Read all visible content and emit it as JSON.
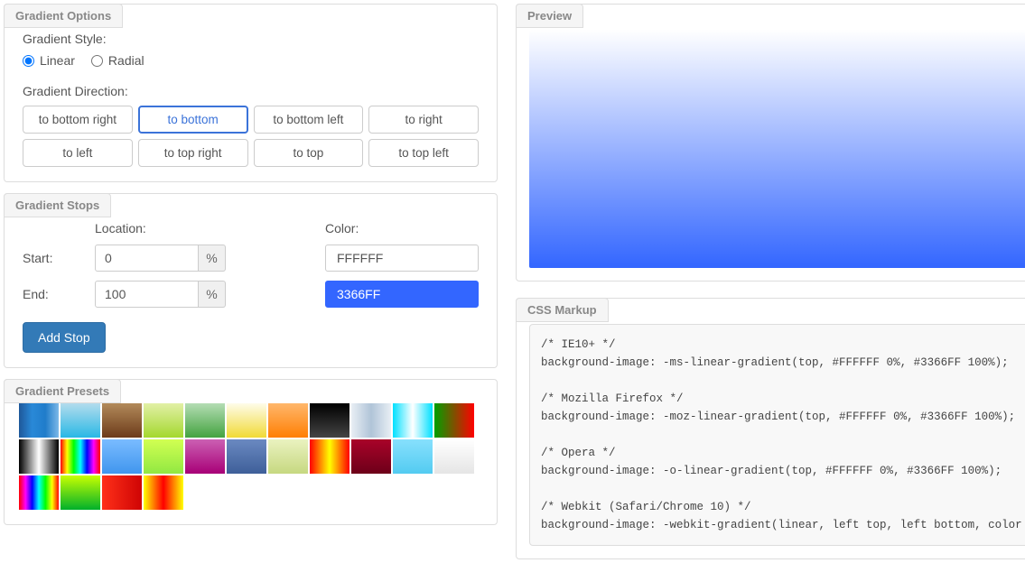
{
  "options": {
    "title": "Gradient Options",
    "styleLabel": "Gradient Style:",
    "styles": {
      "linear": "Linear",
      "radial": "Radial",
      "selected": "linear"
    },
    "directionLabel": "Gradient Direction:",
    "directions": [
      "to bottom right",
      "to bottom",
      "to bottom left",
      "to right",
      "to left",
      "to top right",
      "to top",
      "to top left"
    ],
    "directionActive": "to bottom"
  },
  "stops": {
    "title": "Gradient Stops",
    "locationHdr": "Location:",
    "colorHdr": "Color:",
    "pct": "%",
    "rows": [
      {
        "label": "Start:",
        "loc": "0",
        "color": "FFFFFF",
        "cls": "white"
      },
      {
        "label": "End:",
        "loc": "100",
        "color": "3366FF",
        "cls": "blue"
      }
    ],
    "addBtn": "Add Stop"
  },
  "presets": {
    "title": "Gradient Presets",
    "items": [
      "linear-gradient(to right,#1e5799,#2989d8,#207cca,#7db9e8)",
      "linear-gradient(to bottom,#b3dced,#29b8e5)",
      "linear-gradient(to bottom,#b28a5a,#6d3b1a)",
      "linear-gradient(to bottom,#e2f0a6,#a4d82e)",
      "linear-gradient(to bottom,#b4ddb4,#44a340)",
      "linear-gradient(to bottom,#fefcea,#f1da36)",
      "linear-gradient(to bottom,#ffb76b,#ff7f04)",
      "linear-gradient(to bottom,#000000,#444444)",
      "linear-gradient(to right,#e8eef4,#b0c4d8,#e8eef4)",
      "linear-gradient(to right,#00e0ff,#ffffff,#00e0ff)",
      "linear-gradient(to right,#00a000,#ff0000)",
      "linear-gradient(to right,#000000,#ffffff,#000000)",
      "linear-gradient(to right,#ff0000,#ffff00,#00ff00,#00ffff,#0000ff,#ff00ff,#ff0000)",
      "linear-gradient(to bottom,#7abcff,#4096ee)",
      "linear-gradient(to bottom,#d2ff52,#91e842)",
      "linear-gradient(to bottom,#cb60b3,#a80077)",
      "linear-gradient(to bottom,#6a89c1,#3e5f99)",
      "linear-gradient(to bottom,#eaf2c0,#c6d880)",
      "linear-gradient(to right,#ff0000,#ffff00,#ff0000)",
      "linear-gradient(to bottom,#a90329,#6d0019)",
      "linear-gradient(to bottom,#87e0fd,#53cbf1)",
      "linear-gradient(to bottom,#ffffff,#e5e5e5)",
      "linear-gradient(to right,#ff0000,#ff00ff,#0000ff,#00ffff,#00ff00,#ffff00,#ff0000)",
      "linear-gradient(to bottom,#c9ff00,#00b02b)",
      "linear-gradient(to right,#ff3019,#cf0404)",
      "linear-gradient(to right,#ffff00,#ff0000,#ffff00)"
    ]
  },
  "preview": {
    "title": "Preview",
    "css": "linear-gradient(to bottom,#FFFFFF 0%,#3366FF 100%)"
  },
  "markup": {
    "title": "CSS Markup",
    "code": "/* IE10+ */\nbackground-image: -ms-linear-gradient(top, #FFFFFF 0%, #3366FF 100%);\n\n/* Mozilla Firefox */\nbackground-image: -moz-linear-gradient(top, #FFFFFF 0%, #3366FF 100%);\n\n/* Opera */\nbackground-image: -o-linear-gradient(top, #FFFFFF 0%, #3366FF 100%);\n\n/* Webkit (Safari/Chrome 10) */\nbackground-image: -webkit-gradient(linear, left top, left bottom, color"
  }
}
